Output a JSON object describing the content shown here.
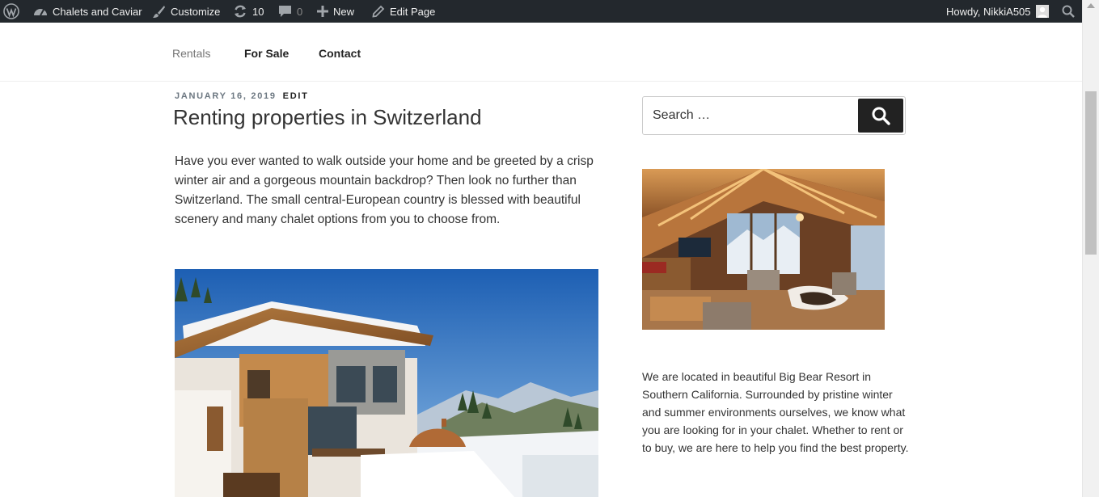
{
  "adminbar": {
    "wp_logo_icon": "wordpress-icon",
    "site_name": "Chalets and Caviar",
    "customize": "Customize",
    "updates_count": "10",
    "comments_count": "0",
    "new_label": "New",
    "edit_page": "Edit Page",
    "howdy": "Howdy, NikkiA505",
    "search_icon": "search-icon"
  },
  "nav": {
    "items": [
      {
        "label": "Rentals",
        "current": true
      },
      {
        "label": "For Sale"
      },
      {
        "label": "Contact"
      }
    ]
  },
  "post": {
    "date": "JANUARY 16, 2019",
    "edit": "EDIT",
    "title": "Renting properties in Switzerland",
    "body": "Have you ever wanted to walk outside your home and be greeted by a crisp winter air and a gorgeous mountain backdrop? Then look no further than Switzerland. The small central-European country is blessed with beautiful scenery and many chalet options from you to choose from."
  },
  "sidebar": {
    "search_placeholder": "Search …",
    "about": "We are located in beautiful Big Bear Resort in Southern California. Surrounded by pristine winter and summer environments ourselves, we know what you are looking for in your chalet. Whether to rent or to buy, we are here to help you find the best property."
  },
  "colors": {
    "adminbar_bg": "#23282d",
    "search_button_bg": "#222222",
    "meta_gray": "#6c7781"
  }
}
